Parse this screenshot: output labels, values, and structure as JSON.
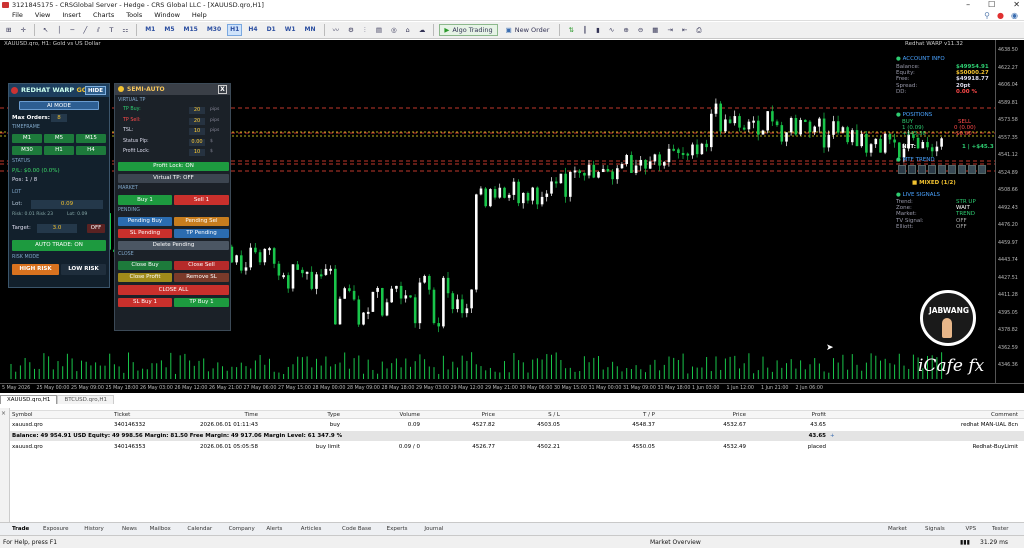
{
  "titlebar": {
    "title": "3121845175 - CRSGlobal Server - Hedge - CRS Global LLC - [XAUUSD.qro,H1]",
    "controls": [
      "–",
      "☐",
      "✕"
    ]
  },
  "menu": {
    "items": [
      "File",
      "View",
      "Insert",
      "Charts",
      "Tools",
      "Window",
      "Help"
    ]
  },
  "toolbar": {
    "timeframes": [
      "M1",
      "M5",
      "M15",
      "M30",
      "H1",
      "H4",
      "D1",
      "W1",
      "MN"
    ],
    "active_timeframe": "H1",
    "algo_trading": "Algo Trading",
    "new_order": "New Order"
  },
  "chart": {
    "header": "XAUUSD.qro, H1: Gold vs US Dollar",
    "header_right": "Redhat WARP v11.32",
    "price_labels": [
      "4638.50",
      "4622.27",
      "4606.04",
      "4589.81",
      "4573.58",
      "4557.35",
      "4541.12",
      "4524.89",
      "4508.66",
      "4492.43",
      "4476.20",
      "4459.97",
      "4443.74",
      "4427.51",
      "4411.28",
      "4395.05",
      "4378.82",
      "4362.59",
      "4346.36"
    ],
    "time_labels": [
      "5 May 2026",
      "25 May 00:00",
      "25 May 09:00",
      "25 May 18:00",
      "26 May 03:00",
      "26 May 12:00",
      "26 May 21:00",
      "27 May 06:00",
      "27 May 15:00",
      "28 May 00:00",
      "28 May 09:00",
      "28 May 18:00",
      "29 May 03:00",
      "29 May 12:00",
      "29 May 21:00",
      "30 May 06:00",
      "30 May 15:00",
      "31 May 00:00",
      "31 May 09:00",
      "31 May 18:00",
      "1 Jun 03:00",
      "1 Jun 12:00",
      "1 Jun 21:00",
      "2 Jun 06:00"
    ]
  },
  "redhat_panel": {
    "title": "REDHAT WARP",
    "title_gold": "GOLD",
    "close_label": "HIDE",
    "mode_button": "AI MODE",
    "max_orders_label": "Max Orders:",
    "max_orders": "8",
    "timeframe_header": "TIMEFRAME",
    "timeframes": [
      "M1",
      "M5",
      "M15",
      "M30",
      "H1",
      "H4"
    ],
    "status_header": "STATUS",
    "pnl": "P/L: $0.00 (0.0%)",
    "pos": "Pos: 1 / 8",
    "lot_header": "LOT",
    "lot_label": "Lot:",
    "lot_value": "0.09",
    "risk_line_left": "Risk: 0.01 Risk 23",
    "risk_line_right": "Lot: 0.09",
    "target_label": "Target:",
    "target_value": "3.0",
    "target_off": "OFF",
    "auto_trade": "AUTO TRADE: ON",
    "risk_header": "RISK MODE",
    "high_risk": "HIGH RISK",
    "low_risk": "LOW RISK"
  },
  "semi_panel": {
    "title": "SEMI-AUTO",
    "close": "X",
    "virtual_header": "VIRTUAL TP",
    "fields": [
      {
        "label": "TP Buy:",
        "value": "20",
        "unit": "pips"
      },
      {
        "label": "TP Sell:",
        "value": "20",
        "unit": "pips"
      },
      {
        "label": "TSL:",
        "value": "10",
        "unit": "pips"
      },
      {
        "label": "Status Pip:",
        "value": "0.00",
        "unit": "$"
      },
      {
        "label": "Profit Lock:",
        "value": "10",
        "unit": "$"
      }
    ],
    "profit_lock": "Profit Lock: ON",
    "virtual_tp": "Virtual TP: OFF",
    "market_header": "MARKET",
    "buy": "Buy 1",
    "sell": "Sell 1",
    "pending_header": "PENDING",
    "pending_buy": "Pending Buy",
    "pending_sell": "Pending Sel",
    "sl_pending": "SL Pending",
    "tp_pending": "TP Pending",
    "delete_pending": "Delete Pending",
    "close_header": "CLOSE",
    "close_buy": "Close Buy",
    "close_sell": "Close Sell",
    "close_profit": "Close Profit",
    "remove_sl": "Remove SL",
    "close_all": "CLOSE ALL",
    "sl_buy": "SL Buy 1",
    "tp_buy": "TP Buy 1"
  },
  "account": {
    "title": "ACCOUNT INFO",
    "rows": [
      {
        "k": "Balance:",
        "v": "$49954.91"
      },
      {
        "k": "Equity:",
        "v": "$50000.27"
      },
      {
        "k": "Free:",
        "v": "$49918.77"
      },
      {
        "k": "Spread:",
        "v": "20pt"
      },
      {
        "k": "DD:",
        "v": "0.00 %"
      }
    ],
    "positions_title": "POSITIONS",
    "buy_label": "BUY",
    "buy_count": "1 (0.09)",
    "buy_pl": "+$45.36",
    "sell_label": "SELL",
    "sell_count": "0 (0.00)",
    "sell_pl": "$0.00",
    "net_label": "NET:",
    "net_value": "1 | +$45.3",
    "mtf_title": "MTF TREND",
    "mixed": "MIXED (1/2)",
    "live_title": "LIVE SIGNALS",
    "live_rows": [
      {
        "k": "Trend:",
        "v": "STR UP"
      },
      {
        "k": "Zone:",
        "v": "WAIT"
      },
      {
        "k": "Market:",
        "v": "TREND"
      },
      {
        "k": "TV Signal:",
        "v": "OFF"
      },
      {
        "k": "Elliott:",
        "v": "OFF"
      }
    ]
  },
  "watermark": {
    "circle": "JABWANG",
    "brand": "iCafe fx"
  },
  "trade": {
    "tabs": [
      "XAUUSD.qro,H1",
      "BTCUSD.qro,H1"
    ],
    "headers": [
      "Symbol",
      "Ticket",
      "Time",
      "Type",
      "Volume",
      "Price",
      "S / L",
      "T / P",
      "Price",
      "Profit",
      "Comment"
    ],
    "rows": [
      [
        "xauusd.qro",
        "340146332",
        "2026.06.01 01:11:43",
        "buy",
        "0.09",
        "4527.82",
        "4503.05",
        "4548.37",
        "4532.67",
        "43.65",
        "redhat MAN-UAL 8cn"
      ],
      [
        "xauusd.qro",
        "340146353",
        "2026.06.01 05:05:58",
        "buy limit",
        "0.09 / 0",
        "4526.77",
        "4502.21",
        "4550.05",
        "4532.49",
        "placed",
        "Redhat-BuyLimit"
      ]
    ],
    "balance_line": "Balance: 49 954.91 USD  Equity: 49 998.56  Margin: 81.50  Free Margin: 49 917.06  Margin Level: 61 347.9 %",
    "balance_profit": "43.65"
  },
  "bottom_tabs": [
    "Trade",
    "Exposure",
    "History",
    "News",
    "Mailbox",
    "Calendar",
    "Company",
    "Alerts",
    "Articles",
    "Code Base",
    "Experts",
    "Journal"
  ],
  "bottom_right": [
    "Market",
    "Signals",
    "VPS",
    "Tester"
  ],
  "status": {
    "left": "For Help, press F1",
    "middle": "Market Overview",
    "right": "31.29 ms"
  }
}
